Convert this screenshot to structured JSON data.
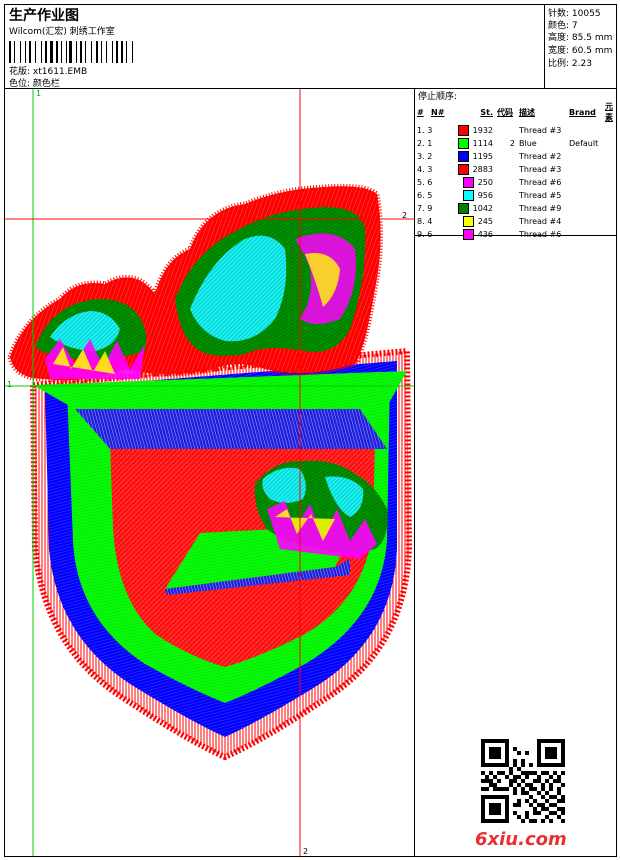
{
  "header": {
    "title": "生产作业图",
    "software": "Wilcom(汇宏) 刺绣工作室",
    "design_label": "花版:",
    "design_file": "xt1611.EMB",
    "color_label": "色位:",
    "color_value": "颜色栏"
  },
  "stats": [
    {
      "label": "针数:",
      "value": "10055"
    },
    {
      "label": "颜色:",
      "value": "7"
    },
    {
      "label": "高度:",
      "value": "85.5 mm"
    },
    {
      "label": "宽度:",
      "value": "60.5 mm"
    },
    {
      "label": "比例:",
      "value": "2.23"
    }
  ],
  "sequence": {
    "title": "停止顺序:",
    "columns": [
      "#",
      "N#",
      "St.",
      "代码",
      "描述",
      "Brand",
      "元素"
    ],
    "rows": [
      {
        "idx": "1.",
        "n": "3",
        "color": "#ff0000",
        "st": "1932",
        "code": "",
        "desc": "Thread #3",
        "brand": ""
      },
      {
        "idx": "2.",
        "n": "1",
        "color": "#00ff00",
        "st": "1114",
        "code": "2",
        "desc": "Blue",
        "brand": "Default"
      },
      {
        "idx": "3.",
        "n": "2",
        "color": "#0000ff",
        "st": "1195",
        "code": "",
        "desc": "Thread #2",
        "brand": ""
      },
      {
        "idx": "4.",
        "n": "3",
        "color": "#ff0000",
        "st": "2883",
        "code": "",
        "desc": "Thread #3",
        "brand": ""
      },
      {
        "idx": "5.",
        "n": "6",
        "color": "#ff00ff",
        "st": "250",
        "code": "",
        "desc": "Thread #6",
        "brand": ""
      },
      {
        "idx": "6.",
        "n": "5",
        "color": "#00ffff",
        "st": "956",
        "code": "",
        "desc": "Thread #5",
        "brand": ""
      },
      {
        "idx": "7.",
        "n": "9",
        "color": "#008000",
        "st": "1042",
        "code": "",
        "desc": "Thread #9",
        "brand": ""
      },
      {
        "idx": "8.",
        "n": "4",
        "color": "#ffff00",
        "st": "245",
        "code": "",
        "desc": "Thread #4",
        "brand": ""
      },
      {
        "idx": "9.",
        "n": "6",
        "color": "#ff00ff",
        "st": "436",
        "code": "",
        "desc": "Thread #6",
        "brand": ""
      }
    ]
  },
  "guides": {
    "h1": "1",
    "v1": "1",
    "h2": "2",
    "v2": "2"
  },
  "watermark": "6xiu.com",
  "colors": {
    "red": "#ff0000",
    "green": "#00ff00",
    "blue": "#0000ff",
    "magenta": "#ff00ff",
    "cyan": "#00ffff",
    "dark_green": "#008000",
    "yellow": "#ffff00"
  }
}
